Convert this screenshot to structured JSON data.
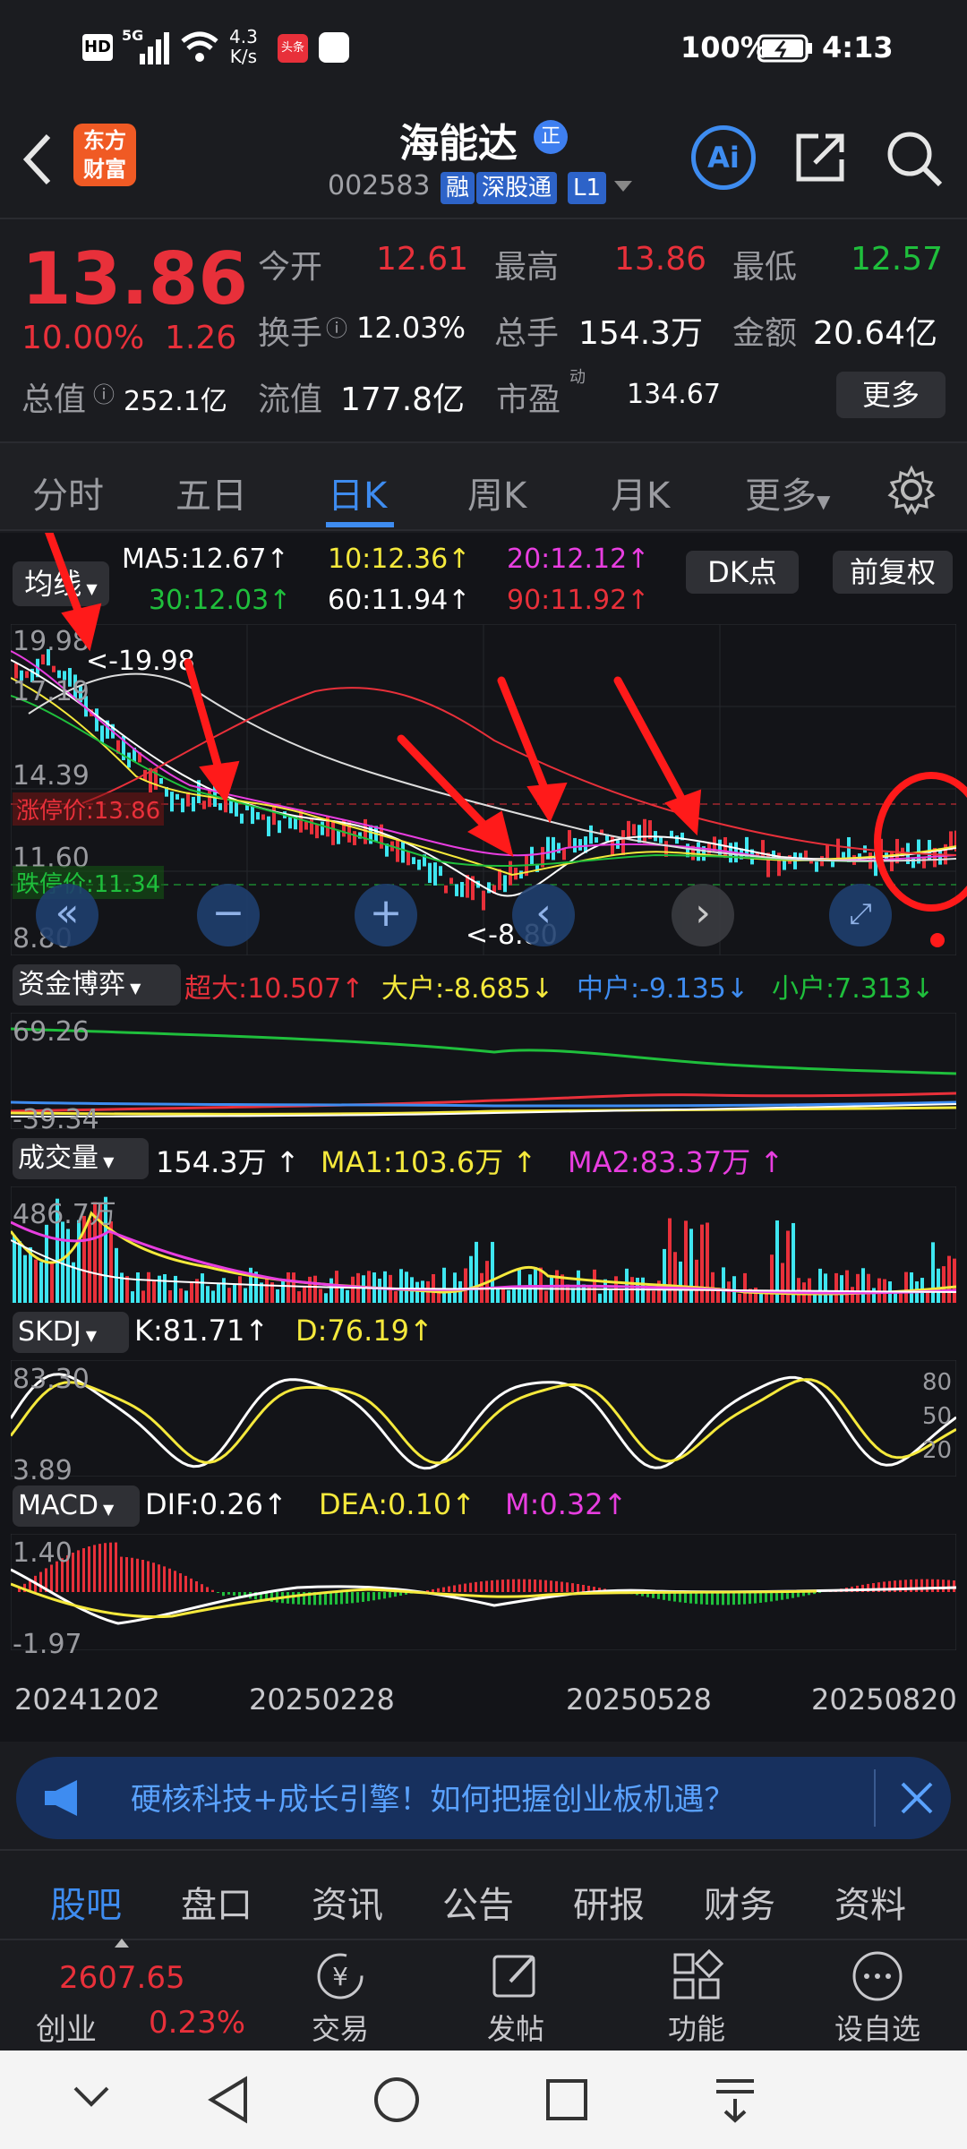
{
  "status": {
    "network_speed": "4.3",
    "speed_unit": "K/s",
    "battery": "100%",
    "time": "4:13",
    "hd": "HD",
    "sig": "5G",
    "app_badge": "头条"
  },
  "header": {
    "logo_line1": "东方",
    "logo_line2": "财富",
    "stock_name": "海能达",
    "badge_zheng": "正",
    "code": "002583",
    "tag_rong": "融",
    "tag_sgt": "深股通",
    "tag_l1": "L1",
    "ai_label": "Ai"
  },
  "quote": {
    "price": "13.86",
    "change_pct": "10.00%",
    "change": "1.26",
    "r1": [
      {
        "k": "今开",
        "v": "12.61",
        "c": "red"
      },
      {
        "k": "最高",
        "v": "13.86",
        "c": "red"
      },
      {
        "k": "最低",
        "v": "12.57",
        "c": "green"
      }
    ],
    "r2": [
      {
        "k": "换手",
        "v": "12.03%"
      },
      {
        "k": "总手",
        "v": "154.3万"
      },
      {
        "k": "金额",
        "v": "20.64亿"
      }
    ],
    "r3": [
      {
        "k": "总值",
        "v": "252.1亿"
      },
      {
        "k": "流值",
        "v": "177.8亿"
      },
      {
        "k": "市盈",
        "v": "134.67",
        "sup": "动"
      }
    ],
    "more": "更多"
  },
  "tabs": [
    "分时",
    "五日",
    "日K",
    "周K",
    "月K",
    "更多"
  ],
  "active_tab": "日K",
  "ma": {
    "btn": "均线",
    "ma5": "MA5:12.67",
    "ma10": "10:12.36",
    "ma20": "20:12.12",
    "ma30": "30:12.03",
    "ma60": "60:11.94",
    "ma90": "90:11.92",
    "dk": "DK点",
    "fq": "前复权"
  },
  "kline": {
    "y_top": "19.98",
    "y2": "17.19",
    "y3": "14.39",
    "y4": "11.60",
    "y_bot": "8.80",
    "high_label": "<-19.98",
    "low_label": "<-8.80",
    "limit_up": "涨停价:13.86",
    "limit_down": "跌停价:11.34"
  },
  "funds": {
    "btn": "资金博弈",
    "chaoda": "超大:10.507",
    "dahu": "大户:-8.685",
    "zhonghu": "中户:-9.135",
    "xiaohu": "小户:7.313",
    "y_top": "69.26",
    "y_bot": "-39.34"
  },
  "volume": {
    "btn": "成交量",
    "vol": "154.3万",
    "ma1": "MA1:103.6万",
    "ma2": "MA2:83.37万",
    "y_top": "486.7万"
  },
  "skdj": {
    "btn": "SKDJ",
    "k": "K:81.71",
    "d": "D:76.19",
    "y_top": "83.30",
    "y_bot": "3.89",
    "r80": "80",
    "r50": "50",
    "r20": "20"
  },
  "macd": {
    "btn": "MACD",
    "dif": "DIF:0.26",
    "dea": "DEA:0.10",
    "m": "M:0.32",
    "y_top": "1.40",
    "y_bot": "-1.97"
  },
  "dates": [
    "20241202",
    "20250228",
    "20250528",
    "20250820"
  ],
  "banner": {
    "text": "硬核科技+成长引擎！如何把握创业板机遇？"
  },
  "subtabs": [
    "股吧",
    "盘口",
    "资讯",
    "公告",
    "研报",
    "财务",
    "资料"
  ],
  "bottom": {
    "index_name": "创业",
    "index_value": "2607.65",
    "index_pct": "0.23%",
    "items": [
      "交易",
      "发帖",
      "功能",
      "设自选"
    ]
  },
  "colors": {
    "up": "#e8303a",
    "down": "#1fbf3c",
    "ma5": "#ffffff",
    "ma10": "#f5e93c",
    "ma20": "#e83ee0",
    "ma30": "#1fbf3c",
    "ma60": "#ffffff",
    "ma90": "#e8303a",
    "accent": "#3e8cf0"
  }
}
